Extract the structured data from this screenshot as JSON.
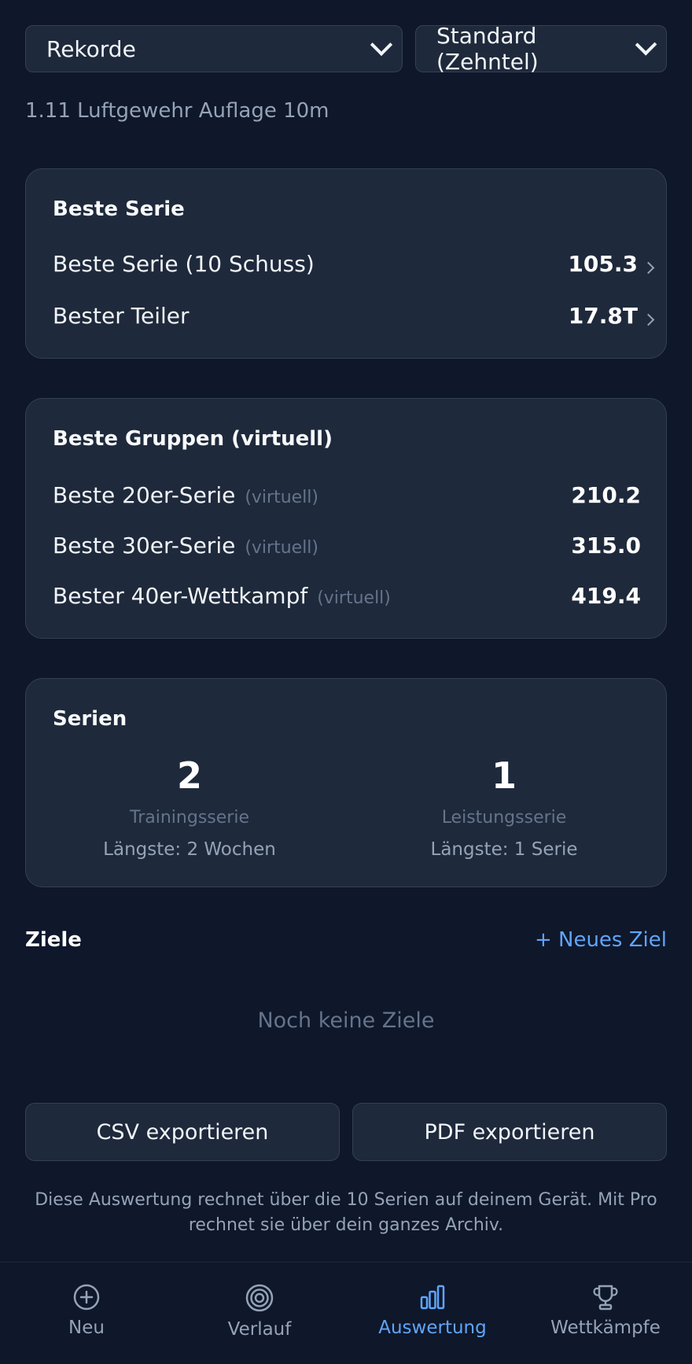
{
  "filters": {
    "category": "Rekorde",
    "scoring": "Standard (Zehntel)"
  },
  "discipline": "1.11 Luftgewehr Auflage 10m",
  "best_series": {
    "title": "Beste Serie",
    "rows": [
      {
        "label": "Beste Serie (10 Schuss)",
        "value": "105.3"
      },
      {
        "label": "Bester Teiler",
        "value": "17.8T"
      }
    ]
  },
  "best_groups": {
    "title": "Beste Gruppen (virtuell)",
    "rows": [
      {
        "label": "Beste 20er-Serie",
        "tag": "(virtuell)",
        "value": "210.2"
      },
      {
        "label": "Beste 30er-Serie",
        "tag": "(virtuell)",
        "value": "315.0"
      },
      {
        "label": "Bester 40er-Wettkampf",
        "tag": "(virtuell)",
        "value": "419.4"
      }
    ]
  },
  "streaks": {
    "title": "Serien",
    "items": [
      {
        "value": "2",
        "label": "Trainingsserie",
        "sub": "Längste: 2 Wochen"
      },
      {
        "value": "1",
        "label": "Leistungsserie",
        "sub": "Längste: 1 Serie"
      }
    ]
  },
  "goals": {
    "title": "Ziele",
    "add_label": "+ Neues Ziel",
    "empty": "Noch keine Ziele"
  },
  "export": {
    "csv": "CSV exportieren",
    "pdf": "PDF exportieren"
  },
  "note": "Diese Auswertung rechnet über die 10 Serien auf deinem Gerät. Mit Pro rechnet sie über dein ganzes Archiv.",
  "nav": {
    "items": [
      {
        "label": "Neu",
        "icon": "plus-circle-icon"
      },
      {
        "label": "Verlauf",
        "icon": "target-icon"
      },
      {
        "label": "Auswertung",
        "icon": "bar-chart-icon",
        "active": true
      },
      {
        "label": "Wettkämpfe",
        "icon": "trophy-icon"
      }
    ],
    "accent": "#60a5fa"
  }
}
